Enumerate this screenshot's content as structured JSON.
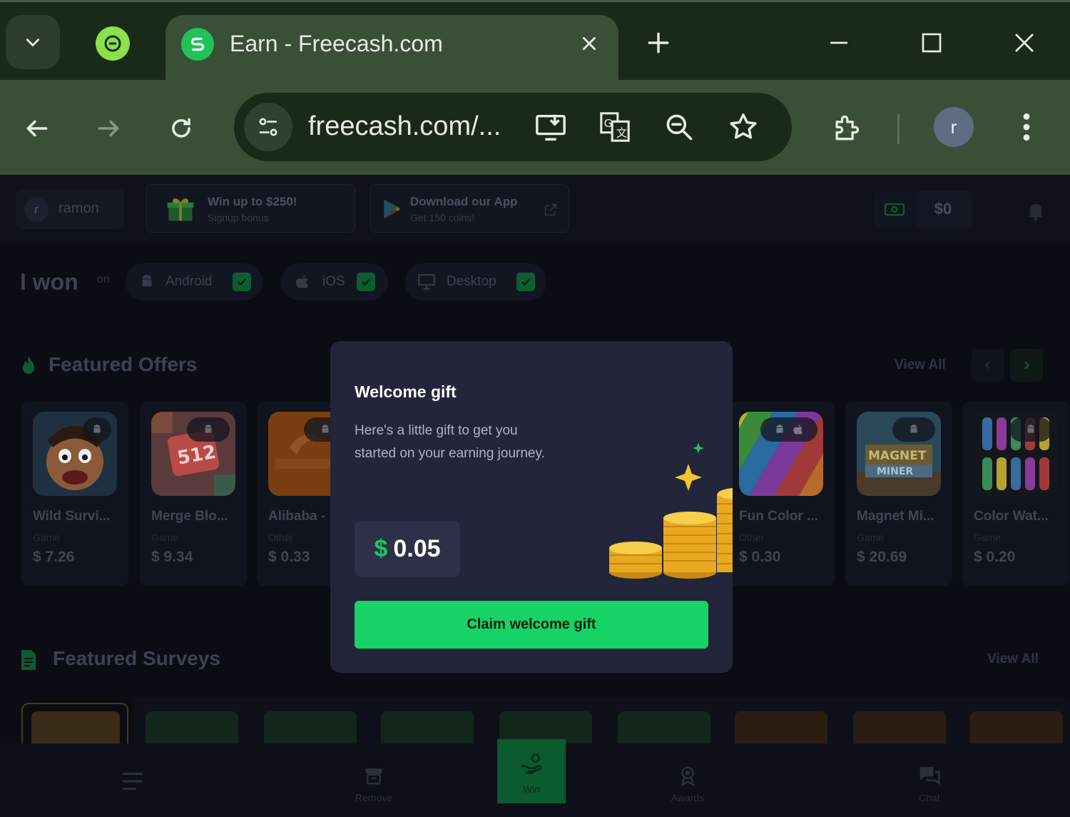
{
  "browser": {
    "tab_title": "Earn - Freecash.com",
    "url": "freecash.com/...",
    "profile_initial": "r",
    "colors": {
      "frame": "#1a2a19",
      "toolbar": "#3a5036"
    }
  },
  "topbar": {
    "username": "ramon",
    "user_initial": "r",
    "promo_signup": {
      "title": "Win up to $250!",
      "subtitle": "Signup bonus"
    },
    "promo_app": {
      "title": "Download our App",
      "subtitle": "Get 150 coins!"
    },
    "balance": "$0"
  },
  "platforms": {
    "heading": "I won",
    "on_label": "on",
    "items": [
      {
        "label": "Android",
        "checked": true
      },
      {
        "label": "iOS",
        "checked": true
      },
      {
        "label": "Desktop",
        "checked": true
      }
    ]
  },
  "featured_offers": {
    "title": "Featured Offers",
    "view_all": "View All",
    "items": [
      {
        "name": "Wild Survi...",
        "category": "Game",
        "price": "$ 7.26"
      },
      {
        "name": "Merge Blo...",
        "category": "Game",
        "price": "$ 9.34"
      },
      {
        "name": "Alibaba -",
        "category": "Other",
        "price": "$ 0.33"
      },
      {
        "name": "Fun Color ...",
        "category": "Other",
        "price": "$ 0.30"
      },
      {
        "name": "Magnet Mi...",
        "category": "Game",
        "price": "$ 20.69"
      },
      {
        "name": "Color Wat...",
        "category": "Game",
        "price": "$ 0.20"
      }
    ]
  },
  "featured_surveys": {
    "title": "Featured Surveys",
    "view_all": "View All"
  },
  "modal": {
    "title": "Welcome gift",
    "description": "Here's a little gift to get you started on your earning journey.",
    "currency": "$",
    "amount": "0.05",
    "claim_label": "Claim welcome gift",
    "accent": "#17d265"
  },
  "bottom_nav": {
    "remove": "Remove",
    "win": "Win",
    "awards": "Awards",
    "chat": "Chat"
  }
}
